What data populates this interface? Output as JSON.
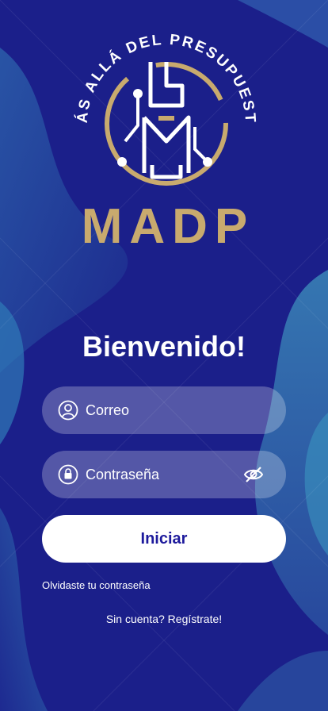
{
  "logo": {
    "tagline": "MÁS ALLÁ DEL PRESUPUESTO",
    "brand": "MADP"
  },
  "login": {
    "welcome": "Bienvenido!",
    "email_placeholder": "Correo",
    "password_placeholder": "Contraseña",
    "submit_label": "Iniciar",
    "forgot_label": "Olvidaste tu contraseña",
    "signup_label": "Sin cuenta? Regístrate!"
  },
  "icons": {
    "email": "user-icon",
    "password": "lock-icon",
    "toggle": "eye-off-icon"
  },
  "colors": {
    "background": "#1b1f8a",
    "accent_gold": "#c8aa6e",
    "button_text": "#1d1a9c"
  }
}
